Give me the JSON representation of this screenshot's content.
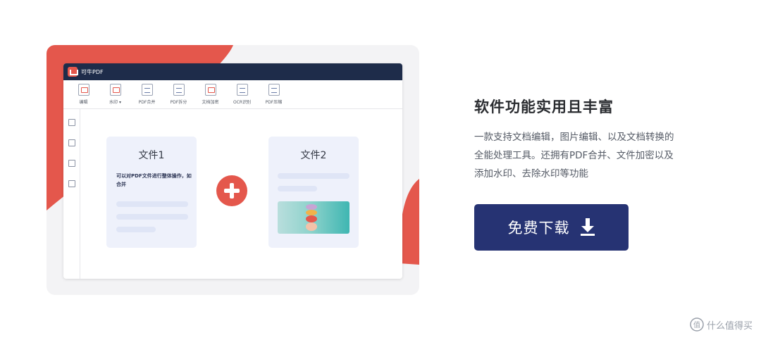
{
  "app": {
    "title": "可牛PDF",
    "accent_color": "#e4574c",
    "titlebar_color": "#1e2c4a"
  },
  "toolbar": {
    "items": [
      {
        "label": "编辑",
        "icon": "edit-icon"
      },
      {
        "label": "水印 ▾",
        "icon": "watermark-icon"
      },
      {
        "label": "PDF合并",
        "icon": "merge-icon"
      },
      {
        "label": "PDF拆分",
        "icon": "split-icon"
      },
      {
        "label": "文档加密",
        "icon": "lock-icon"
      },
      {
        "label": "OCR识别",
        "icon": "ocr-icon"
      },
      {
        "label": "PDF压缩",
        "icon": "compress-icon"
      }
    ]
  },
  "sidebar": {
    "icons": [
      "thumbnail-icon",
      "bookmark-icon",
      "image-icon",
      "page-icon"
    ]
  },
  "documents": [
    {
      "title": "文件1",
      "description": "可以对PDF文件进行整体操作，如合并"
    },
    {
      "title": "文件2"
    }
  ],
  "merge": {
    "icon": "plus-icon"
  },
  "feature": {
    "title": "软件功能实用且丰富",
    "description_lines": [
      "一款支持文档编辑，图片编辑、以及文档转换的",
      "全能处理工具。还拥有PDF合并、文件加密以及",
      "添加水印、去除水印等功能"
    ]
  },
  "download": {
    "label": "免费下载",
    "icon": "download-icon",
    "color": "#263373"
  },
  "watermark": {
    "text": "什么值得买",
    "icon": "zhi-icon"
  }
}
